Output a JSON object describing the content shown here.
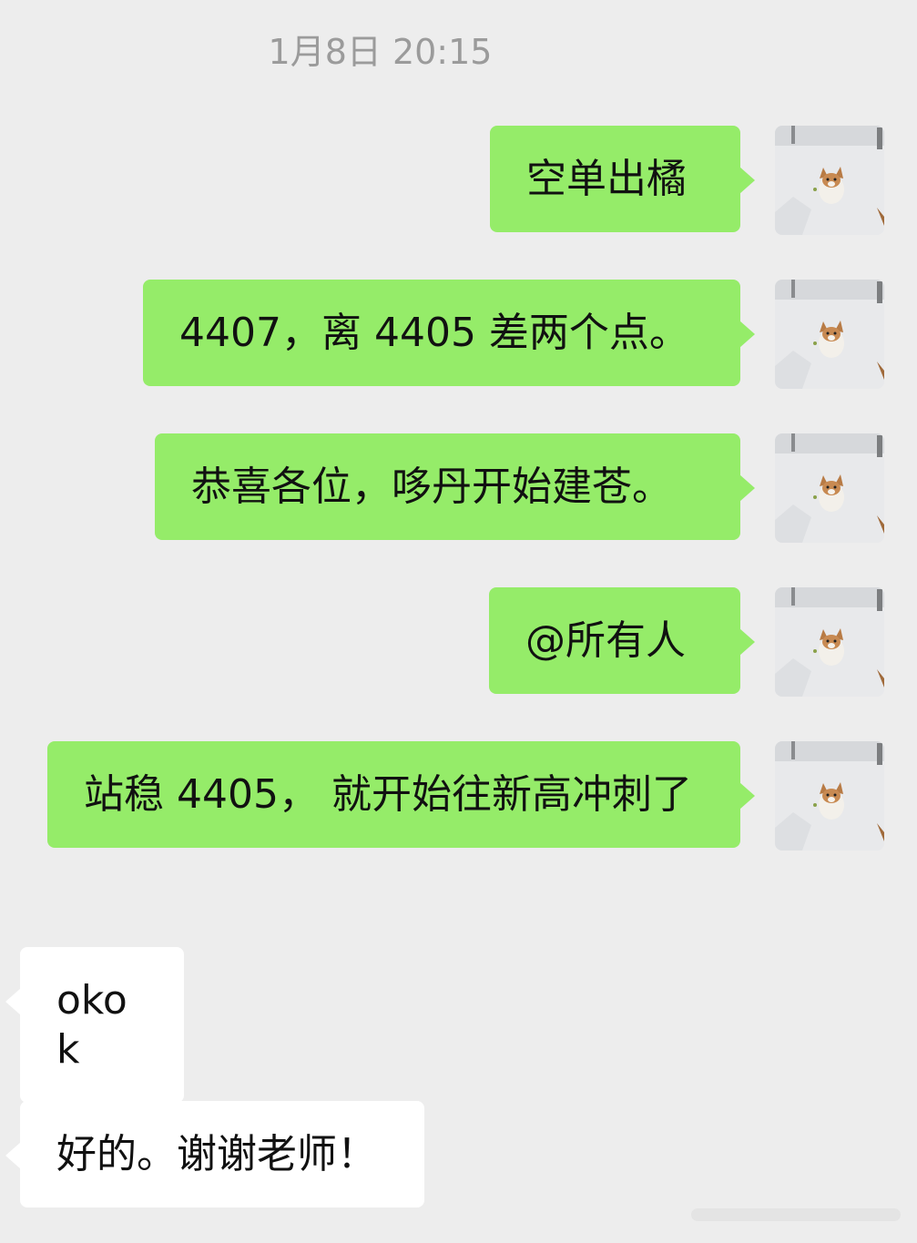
{
  "chat": {
    "timestamp": "1月8日 20:15",
    "messages": [
      {
        "direction": "out",
        "text": "空单出橘"
      },
      {
        "direction": "out",
        "text": "4407，离 4405 差两个点。"
      },
      {
        "direction": "out",
        "text": "恭喜各位，哆丹开始建苍。"
      },
      {
        "direction": "out",
        "text": "@所有人"
      },
      {
        "direction": "out",
        "text": "站稳 4405， 就开始往新高冲刺了"
      },
      {
        "direction": "in",
        "text": "okok"
      },
      {
        "direction": "in",
        "text": "好的。谢谢老师！"
      }
    ]
  },
  "colors": {
    "background": "#ededed",
    "outgoing_bubble": "#95ec69",
    "incoming_bubble": "#ffffff",
    "timestamp_text": "#9b9b9b",
    "message_text": "#111111"
  },
  "icons": {
    "avatar": "corgi-in-snow-avatar-icon"
  }
}
